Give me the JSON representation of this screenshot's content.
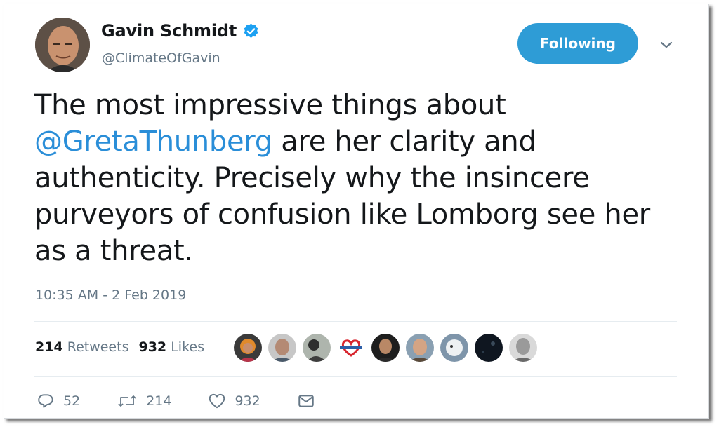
{
  "tweet": {
    "author_name": "Gavin Schmidt",
    "author_handle": "@ClimateOfGavin",
    "follow_label": "Following",
    "text_part1": "The most impressive things about",
    "mention": "@GretaThunberg",
    "text_part2": " are her clarity and authenticity. Precisely why the insincere purveyors of confusion like Lomborg see her as a threat.",
    "timestamp": "10:35 AM - 2 Feb 2019"
  },
  "stats": {
    "retweets_count": "214",
    "retweets_label": "Retweets",
    "likes_count": "932",
    "likes_label": "Likes"
  },
  "likers": [
    {
      "icon": "liker-avatar-1"
    },
    {
      "icon": "liker-avatar-2"
    },
    {
      "icon": "liker-avatar-3"
    },
    {
      "icon": "liker-avatar-4"
    },
    {
      "icon": "liker-avatar-5"
    },
    {
      "icon": "liker-avatar-6"
    },
    {
      "icon": "liker-avatar-7"
    },
    {
      "icon": "liker-avatar-8"
    },
    {
      "icon": "liker-avatar-9"
    }
  ],
  "actions": {
    "reply_count": "52",
    "retweet_count": "214",
    "like_count": "932"
  },
  "colors": {
    "accent": "#1da1f2",
    "follow_button": "#2e9cd6",
    "mention": "#2a8ed8",
    "secondary_text": "#657786"
  }
}
